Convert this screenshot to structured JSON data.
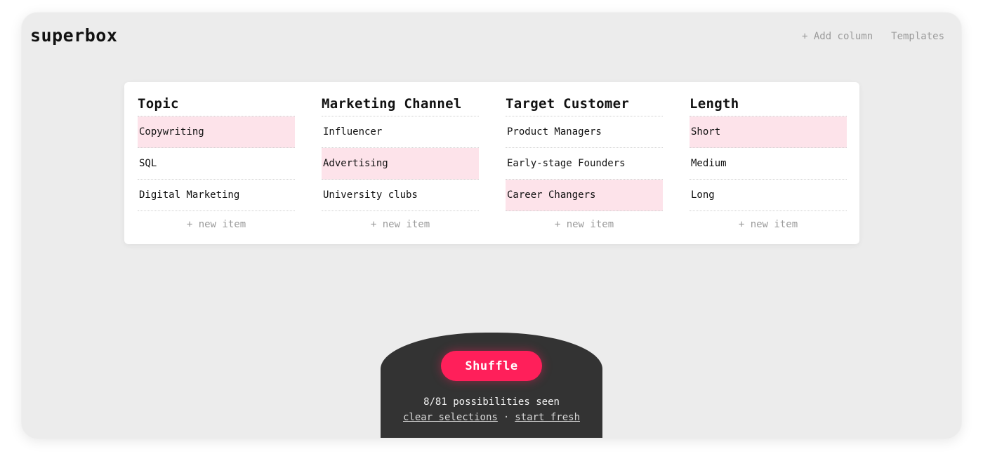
{
  "app": {
    "logo": "superbox"
  },
  "topnav": {
    "add_column": "+ Add column",
    "templates": "Templates"
  },
  "columns": [
    {
      "title": "Topic",
      "items": [
        {
          "label": "Copywriting",
          "selected": true
        },
        {
          "label": "SQL",
          "selected": false
        },
        {
          "label": "Digital Marketing",
          "selected": false
        }
      ],
      "new_item": "+ new item"
    },
    {
      "title": "Marketing Channel",
      "items": [
        {
          "label": "Influencer",
          "selected": false
        },
        {
          "label": "Advertising",
          "selected": true
        },
        {
          "label": "University clubs",
          "selected": false
        }
      ],
      "new_item": "+ new item"
    },
    {
      "title": "Target Customer",
      "items": [
        {
          "label": "Product Managers",
          "selected": false
        },
        {
          "label": "Early-stage Founders",
          "selected": false
        },
        {
          "label": "Career Changers",
          "selected": true
        }
      ],
      "new_item": "+ new item"
    },
    {
      "title": "Length",
      "items": [
        {
          "label": "Short",
          "selected": true
        },
        {
          "label": "Medium",
          "selected": false
        },
        {
          "label": "Long",
          "selected": false
        }
      ],
      "new_item": "+ new item"
    }
  ],
  "dock": {
    "shuffle_label": "Shuffle",
    "possibilities": "8/81 possibilities seen",
    "clear_selections": "clear selections",
    "separator": "·",
    "start_fresh": "start fresh"
  },
  "colors": {
    "accent": "#ff1f5a",
    "selected_bg": "#fde3ea",
    "dock_bg": "#333333",
    "window_bg": "#ececec"
  }
}
